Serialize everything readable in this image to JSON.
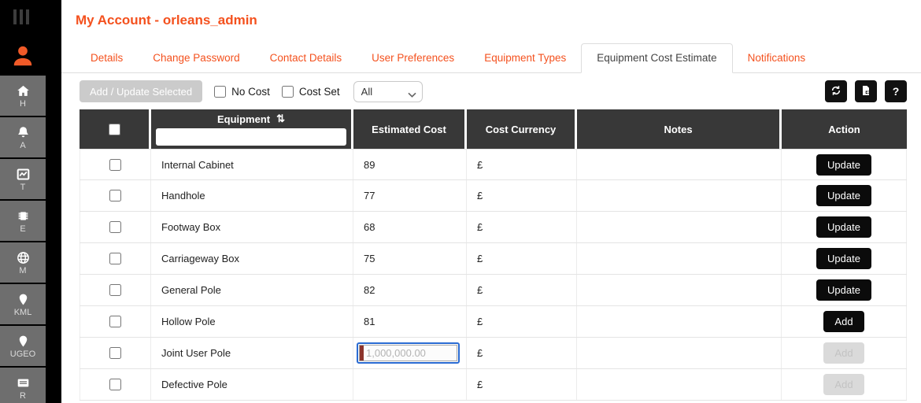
{
  "page": {
    "title": "My Account - orleans_admin"
  },
  "sidebar": {
    "items": [
      {
        "icon": "home-icon",
        "label": "H"
      },
      {
        "icon": "bell-icon",
        "label": "A"
      },
      {
        "icon": "chart-icon",
        "label": "T"
      },
      {
        "icon": "chip-icon",
        "label": "E"
      },
      {
        "icon": "globe-icon",
        "label": "M"
      },
      {
        "icon": "pin-icon",
        "label": "KML"
      },
      {
        "icon": "pin-icon",
        "label": "UGEO"
      },
      {
        "icon": "card-icon",
        "label": "R"
      }
    ]
  },
  "tabs": [
    {
      "label": "Details"
    },
    {
      "label": "Change Password"
    },
    {
      "label": "Contact Details"
    },
    {
      "label": "User Preferences"
    },
    {
      "label": "Equipment Types"
    },
    {
      "label": "Equipment Cost Estimate",
      "active": true
    },
    {
      "label": "Notifications"
    }
  ],
  "toolbar": {
    "add_update_label": "Add / Update Selected",
    "no_cost_label": "No Cost",
    "cost_set_label": "Cost Set",
    "filter_selected": "All",
    "icons": {
      "refresh": "refresh-icon",
      "export": "export-icon",
      "help": "help-icon"
    },
    "help_glyph": "?"
  },
  "table": {
    "headers": {
      "equipment": "Equipment",
      "estimated_cost": "Estimated Cost",
      "cost_currency": "Cost Currency",
      "notes": "Notes",
      "action": "Action"
    },
    "sort_glyph": "⇅",
    "equipment_filter_value": "",
    "rows": [
      {
        "equipment": "Internal Cabinet",
        "estimated_cost": "89",
        "currency": "£",
        "notes": "",
        "action": "Update"
      },
      {
        "equipment": "Handhole",
        "estimated_cost": "77",
        "currency": "£",
        "notes": "",
        "action": "Update"
      },
      {
        "equipment": "Footway Box",
        "estimated_cost": "68",
        "currency": "£",
        "notes": "",
        "action": "Update"
      },
      {
        "equipment": "Carriageway Box",
        "estimated_cost": "75",
        "currency": "£",
        "notes": "",
        "action": "Update"
      },
      {
        "equipment": "General Pole",
        "estimated_cost": "82",
        "currency": "£",
        "notes": "",
        "action": "Update"
      },
      {
        "equipment": "Hollow Pole",
        "estimated_cost": "81",
        "currency": "£",
        "notes": "",
        "action": "Add"
      },
      {
        "equipment": "Joint User Pole",
        "estimated_cost": "",
        "cost_placeholder": "1,000,000.00",
        "currency": "£",
        "notes": "",
        "action": "Add",
        "action_disabled": true
      },
      {
        "equipment": "Defective Pole",
        "estimated_cost": "",
        "currency": "£",
        "notes": "",
        "action": "Add",
        "action_disabled": true
      }
    ]
  },
  "colors": {
    "accent_orange": "#f4511e",
    "table_header_bg": "#383838",
    "focus_blue": "#2a6bd2",
    "caret_red": "#8c342c",
    "button_black": "#0b0b0b"
  }
}
